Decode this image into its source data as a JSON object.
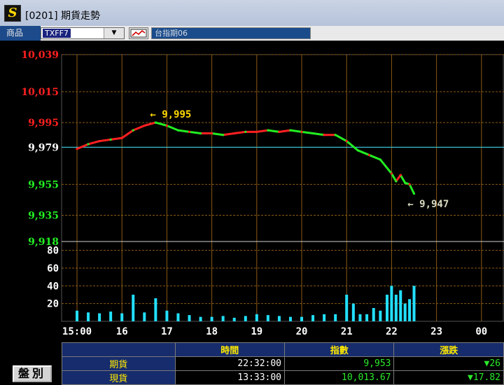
{
  "window": {
    "title": "[0201] 期貨走勢",
    "logo": "S"
  },
  "toolbar": {
    "product_label": "商品",
    "symbol": "TXFF7",
    "description": "台指期06",
    "chart_icon": "line-chart-icon",
    "dropdown_icon": "chevron-down-icon"
  },
  "chart_data": {
    "type": "line",
    "title": "",
    "xlabel": "",
    "ylabel": "",
    "x_ticks": [
      "15:00",
      "16",
      "17",
      "18",
      "19",
      "20",
      "21",
      "22",
      "23",
      "00"
    ],
    "y_ticks": [
      {
        "label": "10,039",
        "value": 10039,
        "color": "#ff2020"
      },
      {
        "label": "10,015",
        "value": 10015,
        "color": "#ff2020"
      },
      {
        "label": "9,995",
        "value": 9995,
        "color": "#ff2020"
      },
      {
        "label": "9,979",
        "value": 9979,
        "color": "#ffffff"
      },
      {
        "label": "9,955",
        "value": 9955,
        "color": "#22ee22"
      },
      {
        "label": "9,935",
        "value": 9935,
        "color": "#22ee22"
      },
      {
        "label": "9,918",
        "value": 9918,
        "color": "#22ee22"
      }
    ],
    "ylim": [
      9918,
      10039
    ],
    "reference_value": 9979,
    "price_series": {
      "x": [
        15.0,
        15.25,
        15.5,
        15.75,
        16.0,
        16.25,
        16.5,
        16.75,
        17.0,
        17.25,
        17.5,
        17.75,
        18.0,
        18.25,
        18.5,
        18.75,
        19.0,
        19.25,
        19.5,
        19.75,
        20.0,
        20.25,
        20.5,
        20.75,
        21.0,
        21.25,
        21.5,
        21.75,
        22.0,
        22.1,
        22.2,
        22.3,
        22.4,
        22.5
      ],
      "y": [
        9978,
        9981,
        9983,
        9984,
        9985,
        9990,
        9993,
        9995,
        9993,
        9990,
        9989,
        9988,
        9988,
        9987,
        9988,
        9989,
        9989,
        9990,
        9989,
        9990,
        9989,
        9988,
        9987,
        9987,
        9983,
        9977,
        9974,
        9971,
        9962,
        9957,
        9961,
        9956,
        9955,
        9949
      ]
    },
    "high": {
      "label": "9,995",
      "value": 9995,
      "x": 16.75
    },
    "low": {
      "label": "9,947",
      "value": 9947,
      "x": 22.45
    },
    "volume": {
      "y_ticks": [
        "80",
        "60",
        "40",
        "20"
      ],
      "ylim": [
        0,
        90
      ],
      "x": [
        15.0,
        15.25,
        15.5,
        15.75,
        16.0,
        16.25,
        16.5,
        16.75,
        17.0,
        17.25,
        17.5,
        17.75,
        18.0,
        18.25,
        18.5,
        18.75,
        19.0,
        19.25,
        19.5,
        19.75,
        20.0,
        20.25,
        20.5,
        20.75,
        21.0,
        21.15,
        21.3,
        21.45,
        21.6,
        21.75,
        21.9,
        22.0,
        22.1,
        22.2,
        22.3,
        22.4,
        22.5
      ],
      "values": [
        12,
        10,
        9,
        11,
        9,
        30,
        10,
        26,
        12,
        9,
        7,
        5,
        5,
        6,
        4,
        6,
        8,
        7,
        6,
        5,
        5,
        7,
        8,
        8,
        30,
        20,
        8,
        8,
        15,
        12,
        30,
        40,
        30,
        35,
        20,
        25,
        40
      ]
    },
    "colors": {
      "up": "#ff2020",
      "down": "#22ee22",
      "volume": "#22e0ff",
      "reference": "#3bbfd0",
      "grid": "#8b5a14"
    }
  },
  "quote_table": {
    "headers": [
      "時間",
      "指數",
      "漲跌"
    ],
    "rows": [
      {
        "label": "期貨",
        "time": "22:32:00",
        "value": "9,953",
        "change": "▼26"
      },
      {
        "label": "現貨",
        "time": "13:33:00",
        "value": "10,013.67",
        "change": "▼17.82"
      }
    ]
  },
  "buttons": {
    "pan": "盤別"
  }
}
